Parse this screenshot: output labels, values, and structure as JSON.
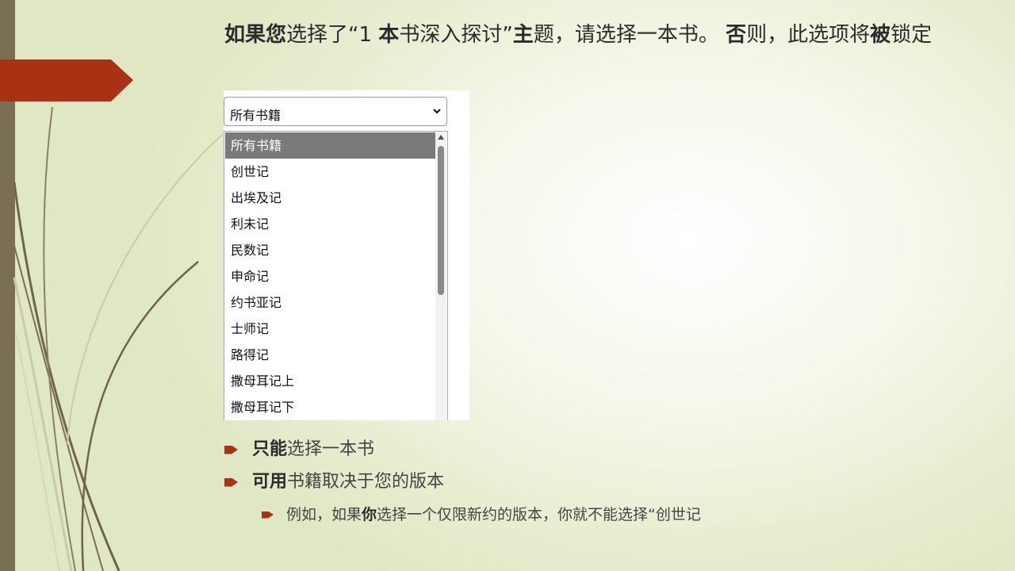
{
  "heading": {
    "p1": "如果您",
    "p2": "选择了“1 ",
    "p3": "本",
    "p4": "书深入探讨”",
    "p5": "主",
    "p6": "题，请选择一本书。 ",
    "p7": "否",
    "p8": "则，此选项将",
    "p9": "被",
    "p10": "锁定"
  },
  "dropdown": {
    "selected_value": "所有书籍",
    "options": [
      "所有书籍",
      "创世记",
      "出埃及记",
      "利未记",
      "民数记",
      "申命记",
      "约书亚记",
      "士师记",
      "路得记",
      "撒母耳记上",
      "撒母耳记下"
    ]
  },
  "bullets": {
    "b1_bold": "只能",
    "b1_rest": "选择一本书",
    "b2_bold": "可用",
    "b2_rest": "书籍取决于您的版本",
    "b3_a": "例如，如果",
    "b3_bold": "你",
    "b3_rest": "选择一个仅限新约的版本，你就不能选择“创世记"
  },
  "colors": {
    "accent": "#a93214",
    "sidebar": "#7a6e54",
    "selected_option": "#7a7a7a"
  },
  "icons": {
    "dropdown": "chevron-down-icon",
    "bullet": "arrow-bullet-icon"
  }
}
